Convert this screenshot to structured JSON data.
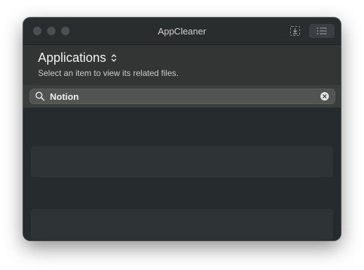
{
  "window": {
    "title": "AppCleaner"
  },
  "toolbar": {
    "download_icon": "download-icon",
    "list_icon": "list-icon"
  },
  "header": {
    "title": "Applications",
    "subtitle": "Select an item to view its related files."
  },
  "search": {
    "value": "Notion",
    "icon": "search-icon",
    "clear_icon": "clear-icon"
  },
  "colors": {
    "window_bg": "#262c2e",
    "titlebar_bg": "#2a2d2e",
    "header_bg": "#333434",
    "search_field_bg": "#525353"
  }
}
